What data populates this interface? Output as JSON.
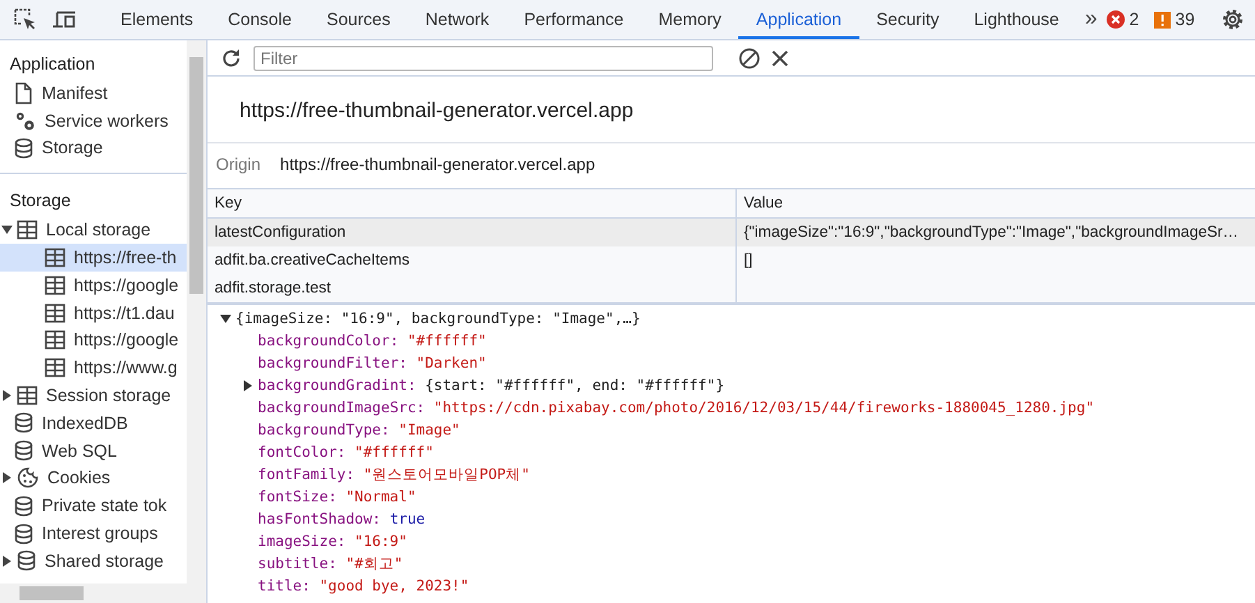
{
  "toolbar": {
    "tabs": [
      {
        "label": "Elements",
        "selected": false
      },
      {
        "label": "Console",
        "selected": false
      },
      {
        "label": "Sources",
        "selected": false
      },
      {
        "label": "Network",
        "selected": false
      },
      {
        "label": "Performance",
        "selected": false
      },
      {
        "label": "Memory",
        "selected": false
      },
      {
        "label": "Application",
        "selected": true
      },
      {
        "label": "Security",
        "selected": false
      },
      {
        "label": "Lighthouse",
        "selected": false
      }
    ],
    "more": "»",
    "errors": "2",
    "warnings": "39"
  },
  "sidebar": {
    "sections": [
      {
        "title": "Application",
        "items": [
          {
            "label": "Manifest",
            "kind": "file",
            "selected": false
          },
          {
            "label": "Service workers",
            "kind": "gear",
            "selected": false
          },
          {
            "label": "Storage",
            "kind": "db",
            "selected": false
          }
        ]
      },
      {
        "title": "Storage",
        "items": [
          {
            "label": "Local storage",
            "kind": "table",
            "expanded": true,
            "selected": false,
            "children": [
              {
                "label": "https://free-th",
                "kind": "table",
                "selected": true
              },
              {
                "label": "https://google",
                "kind": "table",
                "selected": false
              },
              {
                "label": "https://t1.dau",
                "kind": "table",
                "selected": false
              },
              {
                "label": "https://google",
                "kind": "table",
                "selected": false
              },
              {
                "label": "https://www.g",
                "kind": "table",
                "selected": false
              }
            ]
          },
          {
            "label": "Session storage",
            "kind": "table",
            "expanded": false,
            "selected": false
          },
          {
            "label": "IndexedDB",
            "kind": "db",
            "selected": false
          },
          {
            "label": "Web SQL",
            "kind": "db",
            "selected": false
          },
          {
            "label": "Cookies",
            "kind": "cookie",
            "expanded": false,
            "selected": false
          },
          {
            "label": "Private state tok",
            "kind": "db",
            "selected": false
          },
          {
            "label": "Interest groups",
            "kind": "db",
            "selected": false
          },
          {
            "label": "Shared storage",
            "kind": "db",
            "expanded": false,
            "selected": false
          }
        ]
      }
    ]
  },
  "filter": {
    "placeholder": "Filter"
  },
  "origin_title": "https://free-thumbnail-generator.vercel.app",
  "origin": {
    "label": "Origin",
    "value": "https://free-thumbnail-generator.vercel.app"
  },
  "table": {
    "columns": [
      "Key",
      "Value"
    ],
    "rows": [
      {
        "key": "latestConfiguration",
        "value": "{\"imageSize\":\"16:9\",\"backgroundType\":\"Image\",\"backgroundImageSr…",
        "selected": true
      },
      {
        "key": "adfit.ba.creativeCacheItems",
        "value": "[]",
        "selected": false
      },
      {
        "key": "adfit.storage.test",
        "selected": false
      }
    ]
  },
  "preview": {
    "summary": "{imageSize: \"16:9\", backgroundType: \"Image\",…}",
    "expanded": true,
    "properties": [
      {
        "key": "backgroundColor:",
        "value": "\"#ffffff\"",
        "kind": "string"
      },
      {
        "key": "backgroundFilter:",
        "value": "\"Darken\"",
        "kind": "string"
      },
      {
        "key": "backgroundGradint:",
        "value": "{start: \"#ffffff\", end: \"#ffffff\"}",
        "kind": "object",
        "expanded": false
      },
      {
        "key": "backgroundImageSrc:",
        "value": "\"https://cdn.pixabay.com/photo/2016/12/03/15/44/fireworks-1880045_1280.jpg\"",
        "kind": "string"
      },
      {
        "key": "backgroundType:",
        "value": "\"Image\"",
        "kind": "string"
      },
      {
        "key": "fontColor:",
        "value": "\"#ffffff\"",
        "kind": "string"
      },
      {
        "key": "fontFamily:",
        "value": "\"원스토어모바일POP체\"",
        "kind": "string"
      },
      {
        "key": "fontSize:",
        "value": "\"Normal\"",
        "kind": "string"
      },
      {
        "key": "hasFontShadow:",
        "value": "true",
        "kind": "boolean"
      },
      {
        "key": "imageSize:",
        "value": "\"16:9\"",
        "kind": "string"
      },
      {
        "key": "subtitle:",
        "value": "\"#회고\"",
        "kind": "string"
      },
      {
        "key": "title:",
        "value": "\"good bye, 2023!\"",
        "kind": "string"
      }
    ]
  }
}
